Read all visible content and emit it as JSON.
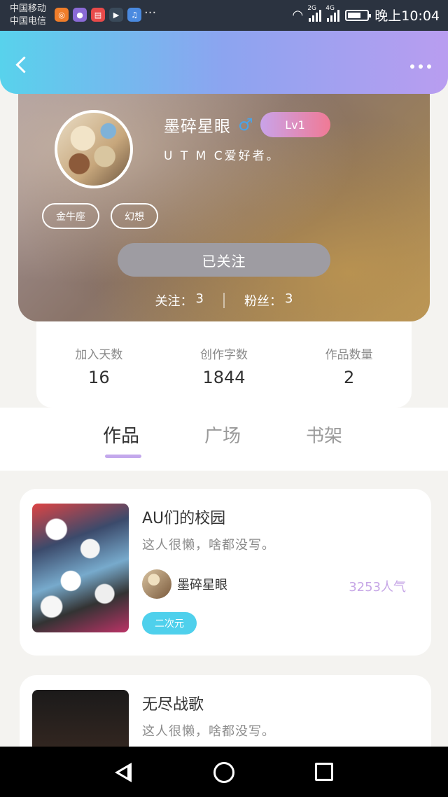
{
  "status_bar": {
    "carrier_1": "中国移动",
    "carrier_2": "中国电信",
    "more": "···",
    "net_1": "2G",
    "net_2": "4G",
    "time": "晚上10:04"
  },
  "profile": {
    "username": "墨碎星眼",
    "gender_symbol": "♂",
    "level": "Lv1",
    "bio": "U T  M C爱好者。",
    "tags": [
      "金牛座",
      "幻想"
    ],
    "follow_button": "已关注",
    "following_label": "关注：",
    "following_count": "3",
    "fans_label": "粉丝：",
    "fans_count": "3"
  },
  "stats": [
    {
      "label": "加入天数",
      "value": "16"
    },
    {
      "label": "创作字数",
      "value": "1844"
    },
    {
      "label": "作品数量",
      "value": "2"
    }
  ],
  "tabs": [
    "作品",
    "广场",
    "书架"
  ],
  "works": [
    {
      "title": "AU们的校园",
      "desc": "这人很懒，啥都没写。",
      "author": "墨碎星眼",
      "popularity": "3253人气",
      "genre": "二次元"
    },
    {
      "title": "无尽战歌",
      "desc": "这人很懒，啥都没写。"
    }
  ],
  "colors": {
    "header_start": "#58d2ec",
    "header_end": "#b99df0",
    "accent_purple": "#c3a8ec",
    "genre_tag": "#4fd0ec",
    "follow_button": "#9e9ca2"
  }
}
